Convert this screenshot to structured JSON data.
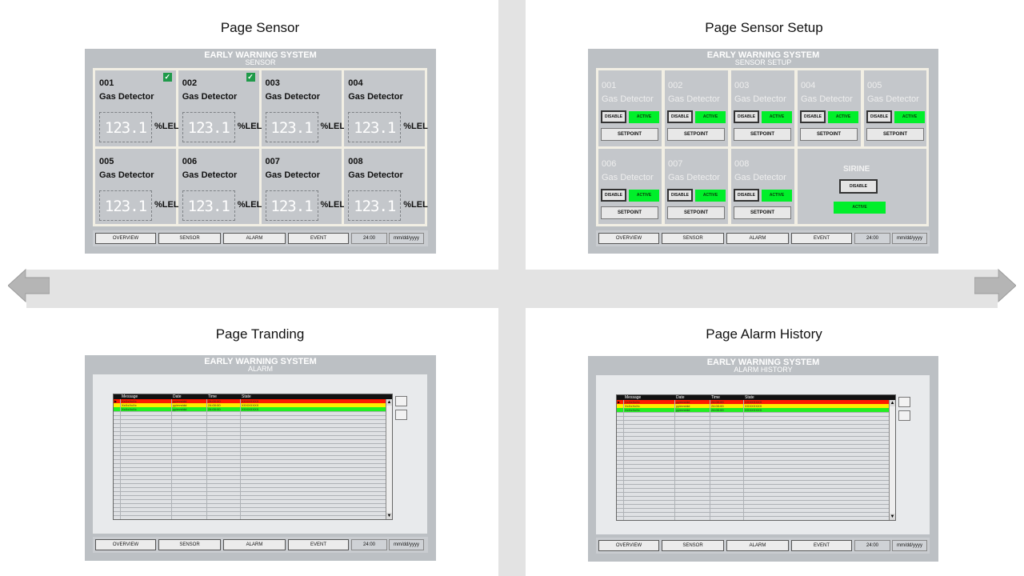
{
  "quadrants": {
    "sensor": {
      "title": "Page Sensor"
    },
    "setup": {
      "title": "Page Sensor Setup"
    },
    "trending": {
      "title": "Page Tranding"
    },
    "history": {
      "title": "Page Alarm History"
    }
  },
  "hmi": {
    "system_name": "EARLY WARNING SYSTEM",
    "sensor_sub": "SENSOR",
    "setup_sub": "SENSOR SETUP",
    "alarm_sub": "ALARM",
    "history_sub": "ALARM HISTORY"
  },
  "nav": {
    "overview": "OVERVIEW",
    "sensor": "SENSOR",
    "alarm": "ALARM",
    "event": "EVENT",
    "time": "24:00",
    "date": "mm/dd/yyyy"
  },
  "sensors": [
    {
      "id": "001",
      "name": "Gas Detector",
      "value": "123.1",
      "unit": "%LEL",
      "checked": true
    },
    {
      "id": "002",
      "name": "Gas Detector",
      "value": "123.1",
      "unit": "%LEL",
      "checked": true
    },
    {
      "id": "003",
      "name": "Gas Detector",
      "value": "123.1",
      "unit": "%LEL",
      "checked": false
    },
    {
      "id": "004",
      "name": "Gas Detector",
      "value": "123.1",
      "unit": "%LEL",
      "checked": false
    },
    {
      "id": "005",
      "name": "Gas Detector",
      "value": "123.1",
      "unit": "%LEL",
      "checked": false
    },
    {
      "id": "006",
      "name": "Gas Detector",
      "value": "123.1",
      "unit": "%LEL",
      "checked": false
    },
    {
      "id": "007",
      "name": "Gas Detector",
      "value": "123.1",
      "unit": "%LEL",
      "checked": false
    },
    {
      "id": "008",
      "name": "Gas Detector",
      "value": "123.1",
      "unit": "%LEL",
      "checked": false
    }
  ],
  "setup": {
    "disable_label": "DISABLE",
    "active_label": "ACTIVE",
    "setpoint_label": "SETPOINT",
    "sirine_label": "SIRINE",
    "sensors": [
      {
        "id": "001",
        "name": "Gas Detector"
      },
      {
        "id": "002",
        "name": "Gas Detector"
      },
      {
        "id": "003",
        "name": "Gas Detector"
      },
      {
        "id": "004",
        "name": "Gas Detector"
      },
      {
        "id": "005",
        "name": "Gas Detector"
      },
      {
        "id": "006",
        "name": "Gas Detector"
      },
      {
        "id": "007",
        "name": "Gas Detector"
      },
      {
        "id": "008",
        "name": "Gas Detector"
      }
    ]
  },
  "alarm_table": {
    "columns": [
      "Message",
      "Date",
      "Time",
      "State"
    ],
    "rows": [
      {
        "message": "XxXxXxXx",
        "date": "yy/mm/dd",
        "time": "24:00:00",
        "state": "XXXXXXXX",
        "color": "#ff1a00"
      },
      {
        "message": "XxXxXxXx",
        "date": "yy/mm/dd",
        "time": "24:00:00",
        "state": "XXXXXXXX",
        "color": "#ffee00"
      },
      {
        "message": "XxXxXxXx",
        "date": "yy/mm/dd",
        "time": "24:00:00",
        "state": "XXXXXXXX",
        "color": "#22ee22"
      }
    ]
  },
  "colors": {
    "active_green": "#00ef2a",
    "panel_grey": "#bcc0c4",
    "check_green": "#1f9a4a"
  }
}
